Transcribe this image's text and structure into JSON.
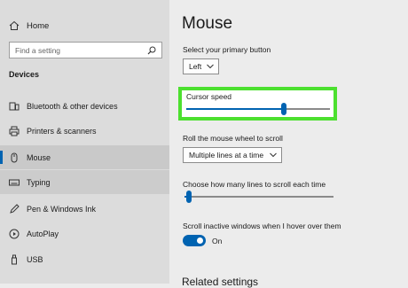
{
  "sidebar": {
    "home_label": "Home",
    "search_placeholder": "Find a setting",
    "section_label": "Devices",
    "items": [
      {
        "label": "Bluetooth & other devices",
        "icon": "bluetooth-icon"
      },
      {
        "label": "Printers & scanners",
        "icon": "printer-icon"
      },
      {
        "label": "Mouse",
        "icon": "mouse-icon",
        "selected": true
      },
      {
        "label": "Typing",
        "icon": "keyboard-icon"
      },
      {
        "label": "Pen & Windows Ink",
        "icon": "pen-icon"
      },
      {
        "label": "AutoPlay",
        "icon": "autoplay-icon"
      },
      {
        "label": "USB",
        "icon": "usb-icon"
      }
    ]
  },
  "main": {
    "title": "Mouse",
    "primary_button": {
      "label": "Select your primary button",
      "value": "Left"
    },
    "cursor_speed": {
      "label": "Cursor speed",
      "level": 0.68
    },
    "wheel": {
      "label": "Roll the mouse wheel to scroll",
      "value": "Multiple lines at a time"
    },
    "lines": {
      "label": "Choose how many lines to scroll each time",
      "level": 0.03
    },
    "inactive_scroll": {
      "label": "Scroll inactive windows when I hover over them",
      "state": "On"
    },
    "related_heading": "Related settings"
  },
  "colors": {
    "accent": "#0063b1",
    "highlight": "#4ce02f",
    "sidebar_bg": "#dcdcdc",
    "main_bg": "#ececec"
  }
}
